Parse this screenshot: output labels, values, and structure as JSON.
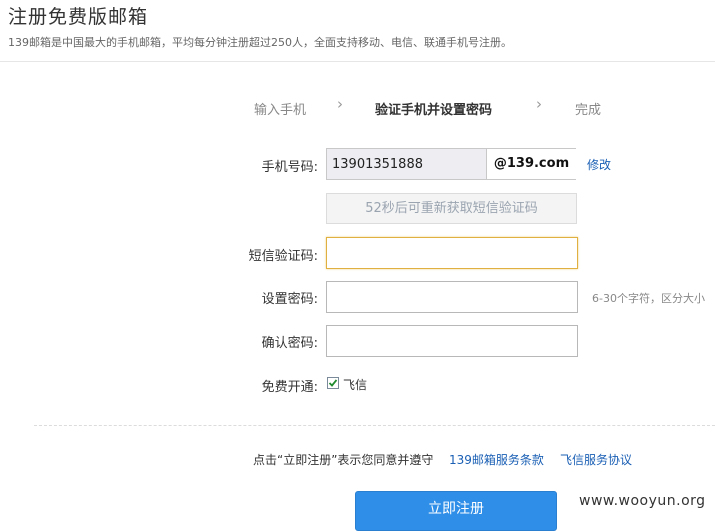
{
  "header": {
    "title": "注册免费版邮箱",
    "subtitle": "139邮箱是中国最大的手机邮箱，平均每分钟注册超过250人，全面支持移动、电信、联通手机号注册。"
  },
  "steps": [
    {
      "label": "输入手机",
      "state": "done"
    },
    {
      "label": "验证手机并设置密码",
      "state": "active"
    },
    {
      "label": "完成",
      "state": "pending"
    }
  ],
  "form": {
    "phone_label": "手机号码:",
    "phone_value": "13901351888",
    "phone_domain": "@139.com",
    "modify_link": "修改",
    "resend_button": "52秒后可重新获取短信验证码",
    "sms_label": "短信验证码:",
    "sms_value": "",
    "password_label": "设置密码:",
    "password_value": "",
    "password_hint": "6-30个字符，区分大小",
    "confirm_label": "确认密码:",
    "confirm_value": "",
    "free_label": "免费开通:",
    "fetion_option": "飞信",
    "fetion_checked": true
  },
  "agreement": {
    "text": "点击“立即注册”表示您同意并遵守",
    "terms_link": "139邮箱服务条款",
    "fetion_link": "飞信服务协议"
  },
  "submit_label": "立即注册",
  "watermark": "www.wooyun.org",
  "colors": {
    "link": "#1a5fb4",
    "button": "#2f8fe8",
    "focus_border": "#e0b040"
  }
}
